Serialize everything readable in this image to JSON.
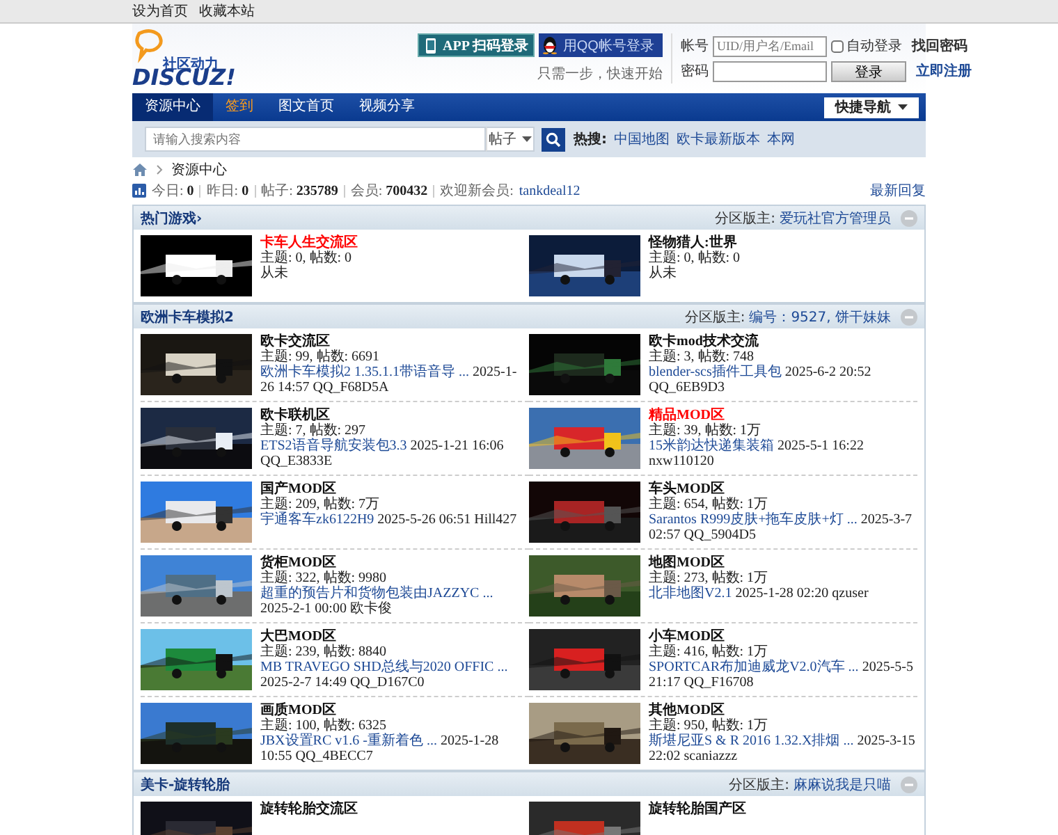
{
  "top_links": [
    "设为首页",
    "收藏本站"
  ],
  "logo": {
    "tagline": "社区动力",
    "wordmark": "DISCUZ!"
  },
  "quick_login": {
    "app_button": "APP 扫码登录",
    "qq_button": "用QQ帐号登录",
    "hint": "只需一步，快速开始"
  },
  "login": {
    "account_label": "帐号",
    "account_placeholder": "UID/用户名/Email",
    "auto_login": {
      "label": "自动登录",
      "checked": false
    },
    "forgot": "找回密码",
    "password_label": "密码",
    "submit": "登录",
    "register": "立即注册"
  },
  "nav": {
    "items": [
      {
        "label": "资源中心",
        "selected": true,
        "highlight": false
      },
      {
        "label": "签到",
        "selected": false,
        "highlight": true
      },
      {
        "label": "图文首页",
        "selected": false,
        "highlight": false
      },
      {
        "label": "视频分享",
        "selected": false,
        "highlight": false
      }
    ],
    "quick_nav": "快捷导航"
  },
  "search": {
    "placeholder": "请输入搜索内容",
    "scope": "帖子",
    "hot_label": "热搜:",
    "hot": [
      "中国地图",
      "欧卡最新版本",
      "本网"
    ]
  },
  "breadcrumb": [
    "资源中心"
  ],
  "stats": [
    {
      "label": "今日:",
      "value": "0"
    },
    {
      "label": "昨日:",
      "value": "0"
    },
    {
      "label": "帖子:",
      "value": "235789"
    },
    {
      "label": "会员:",
      "value": "700432"
    },
    {
      "label": "欢迎新会员:",
      "link": "tankdeal12"
    }
  ],
  "latest_replies": "最新回复",
  "sections": [
    {
      "title": "热门游戏›",
      "moderator_label": "分区版主:",
      "moderators": "爱玩社官方管理员",
      "forums": [
        {
          "name": "卡车人生交流区",
          "highlight": true,
          "stats": "主题: 0, 帖数: 0",
          "last_meta": "从未"
        },
        {
          "name": "怪物猎人:世界",
          "highlight": false,
          "stats": "主题: 0, 帖数: 0",
          "last_meta": "从未"
        }
      ]
    },
    {
      "title": "欧洲卡车模拟2",
      "moderator_label": "分区版主:",
      "moderators": "编号：9527, 饼干妹妹",
      "forums": [
        {
          "name": "欧卡交流区",
          "highlight": false,
          "stats": "主题: 99, 帖数: 6691",
          "last_link": "欧洲卡车模拟2 1.35.1.1带语音导 ...",
          "last_meta": "2025-1-26 14:57 QQ_F68D5A"
        },
        {
          "name": "欧卡mod技术交流",
          "highlight": false,
          "stats": "主题: 3, 帖数: 748",
          "last_link": "blender-scs插件工具包",
          "last_meta": "2025-6-2 20:52 QQ_6EB9D3"
        },
        {
          "name": "欧卡联机区",
          "highlight": false,
          "stats": "主题: 7, 帖数: 297",
          "last_link": "ETS2语音导航安装包3.3",
          "last_meta": "2025-1-21 16:06 QQ_E3833E"
        },
        {
          "name": "精品MOD区",
          "highlight": true,
          "stats": "主题: 39, 帖数: 1万",
          "last_link": "15米韵达快递集装箱",
          "last_meta": "2025-5-1 16:22 nxw110120"
        },
        {
          "name": "国产MOD区",
          "highlight": false,
          "stats": "主题: 209, 帖数: 7万",
          "last_link": "宇通客车zk6122H9",
          "last_meta": "2025-5-26 06:51 Hill427"
        },
        {
          "name": "车头MOD区",
          "highlight": false,
          "stats": "主题: 654, 帖数: 1万",
          "last_link": "Sarantos R999皮肤+拖车皮肤+灯 ...",
          "last_meta": "2025-3-7 02:57 QQ_5904D5"
        },
        {
          "name": "货柜MOD区",
          "highlight": false,
          "stats": "主题: 322, 帖数: 9980",
          "last_link": "超重的预告片和货物包装由JAZZYC ...",
          "last_meta": "2025-2-1 00:00 欧卡俊"
        },
        {
          "name": "地图MOD区",
          "highlight": false,
          "stats": "主题: 273, 帖数: 1万",
          "last_link": "北非地图V2.1",
          "last_meta": "2025-1-28 02:20 qzuser"
        },
        {
          "name": "大巴MOD区",
          "highlight": false,
          "stats": "主题: 239, 帖数: 8840",
          "last_link": "MB TRAVEGO SHD总线与2020 OFFIC ...",
          "last_meta": "2025-2-7 14:49 QQ_D167C0"
        },
        {
          "name": "小车MOD区",
          "highlight": false,
          "stats": "主题: 416, 帖数: 1万",
          "last_link": "SPORTCAR布加迪威龙V2.0汽车 ...",
          "last_meta": "2025-5-5 21:17 QQ_F16708"
        },
        {
          "name": "画质MOD区",
          "highlight": false,
          "stats": "主题: 100, 帖数: 6325",
          "last_link": "JBX设置RC v1.6 -重新着色 ...",
          "last_meta": "2025-1-28 10:55 QQ_4BECC7"
        },
        {
          "name": "其他MOD区",
          "highlight": false,
          "stats": "主题: 950, 帖数: 1万",
          "last_link": "斯堪尼亚S & R 2016 1.32.X排烟 ...",
          "last_meta": "2025-3-15 22:02 scaniazzz"
        }
      ]
    },
    {
      "title": "美卡-旋转轮胎",
      "moderator_label": "分区版主:",
      "moderators": "麻麻说我是只喵",
      "forums": [
        {
          "name": "旋转轮胎交流区",
          "highlight": false
        },
        {
          "name": "旋转轮胎国产区",
          "highlight": false
        }
      ]
    }
  ]
}
